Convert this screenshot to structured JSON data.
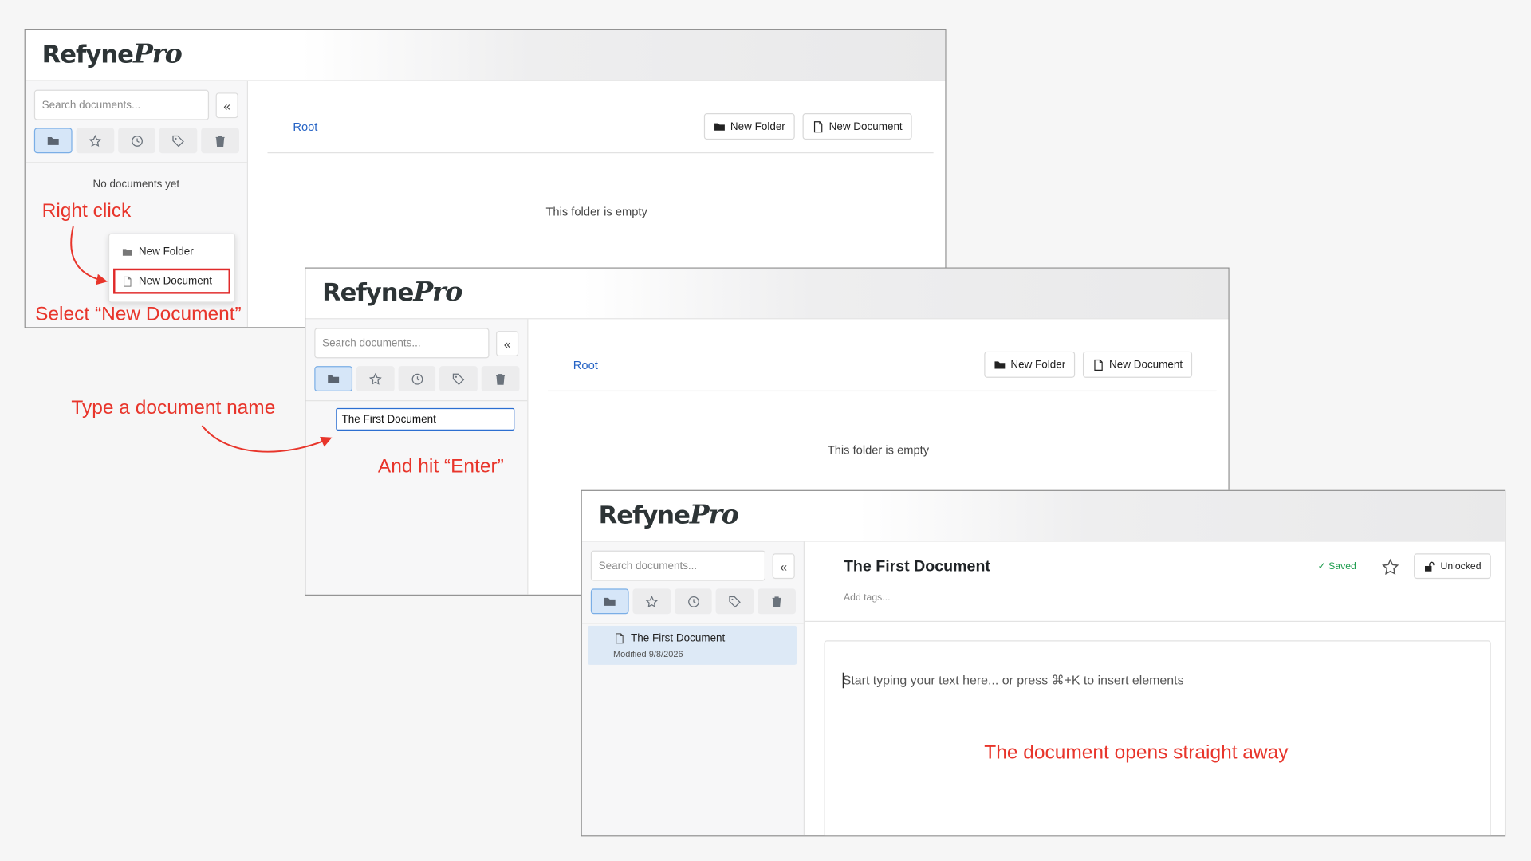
{
  "app": {
    "logo_main": "Refyne",
    "logo_pro": "Pro"
  },
  "sidebar": {
    "search_placeholder": "Search documents...",
    "collapse_label": "«",
    "tabs": [
      "folder-icon",
      "star-icon",
      "clock-icon",
      "tag-icon",
      "trash-icon"
    ]
  },
  "main": {
    "breadcrumb_root": "Root",
    "new_folder_label": "New Folder",
    "new_document_label": "New Document",
    "empty_message": "This folder is empty"
  },
  "step1": {
    "no_documents": "No documents yet",
    "context_menu": {
      "new_folder": "New Folder",
      "new_document": "New Document"
    }
  },
  "step2": {
    "name_input_value": "The First Document"
  },
  "step3": {
    "doc_item_title": "The First Document",
    "doc_item_modified": "Modified 9/8/2026",
    "doc_title": "The First Document",
    "tags_placeholder": "Add tags...",
    "saved_status": "✓ Saved",
    "lock_label": "Unlocked",
    "editor_placeholder": "Start typing your text here... or press ⌘+K to insert elements"
  },
  "annotations": {
    "right_click": "Right click",
    "select_new_document": "Select “New Document”",
    "type_name": "Type a document name",
    "hit_enter": "And hit “Enter”",
    "opens": "The document opens straight away"
  },
  "colors": {
    "annotation": "#e8352b",
    "link": "#2563c5",
    "saved": "#1f9d4f",
    "active_tab": "#d6e6f8"
  }
}
